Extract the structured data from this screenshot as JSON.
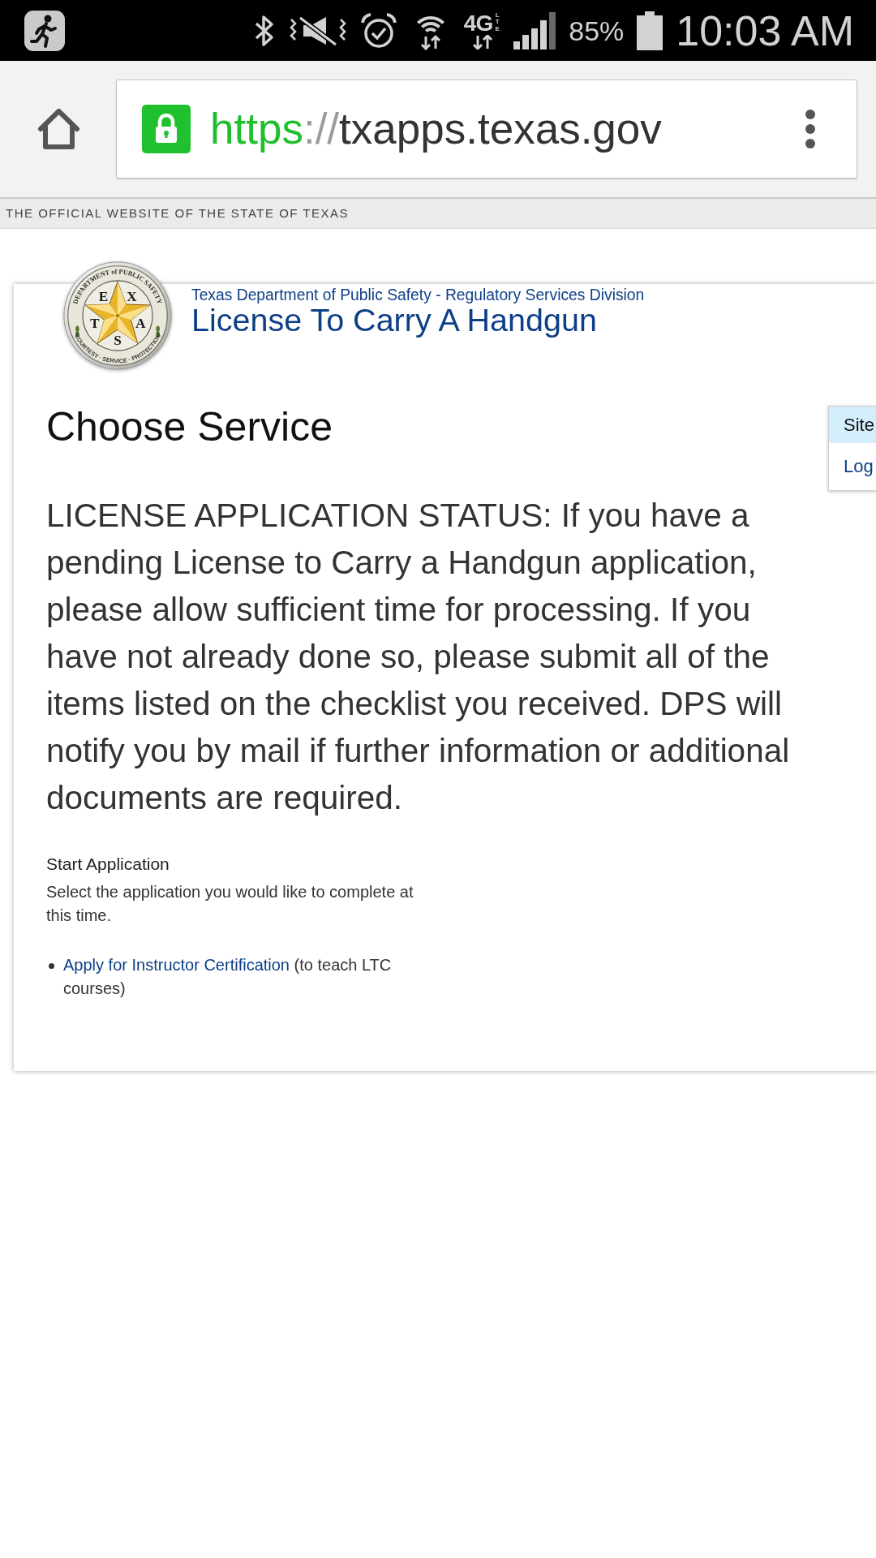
{
  "status_bar": {
    "network": "4G",
    "network_sub": "LTE",
    "battery": "85%",
    "time": "10:03 AM"
  },
  "browser": {
    "url": {
      "scheme": "https",
      "separator": "://",
      "host": "txapps.texas.gov"
    }
  },
  "banner": {
    "text": "THE OFFICIAL WEBSITE OF THE STATE OF TEXAS"
  },
  "header": {
    "seal": {
      "top_text": "DEPARTMENT of PUBLIC SAFETY",
      "letters": [
        "E",
        "X",
        "T",
        "A",
        "S"
      ],
      "bottom_text": "COURTESY · SERVICE · PROTECTION"
    },
    "agency": "Texas Department of Public Safety - Regulatory Services Division",
    "title": "License To Carry A Handgun"
  },
  "side_menu": {
    "items": [
      {
        "label": "Site",
        "selected": true
      },
      {
        "label": "Log",
        "selected": false
      }
    ]
  },
  "content": {
    "heading": "Choose Service",
    "notice": "LICENSE APPLICATION STATUS: If you have a pending License to Carry a Handgun application, please allow sufficient time for processing. If you have not already done so, please submit all of the items listed on the checklist you received. DPS will notify you by mail if further information or additional documents are required.",
    "section": {
      "title": "Start Application",
      "description": "Select the application you would like to complete at this time.",
      "options": [
        {
          "link": "Apply for Instructor Certification",
          "note": "(to teach LTC courses)"
        }
      ]
    }
  }
}
